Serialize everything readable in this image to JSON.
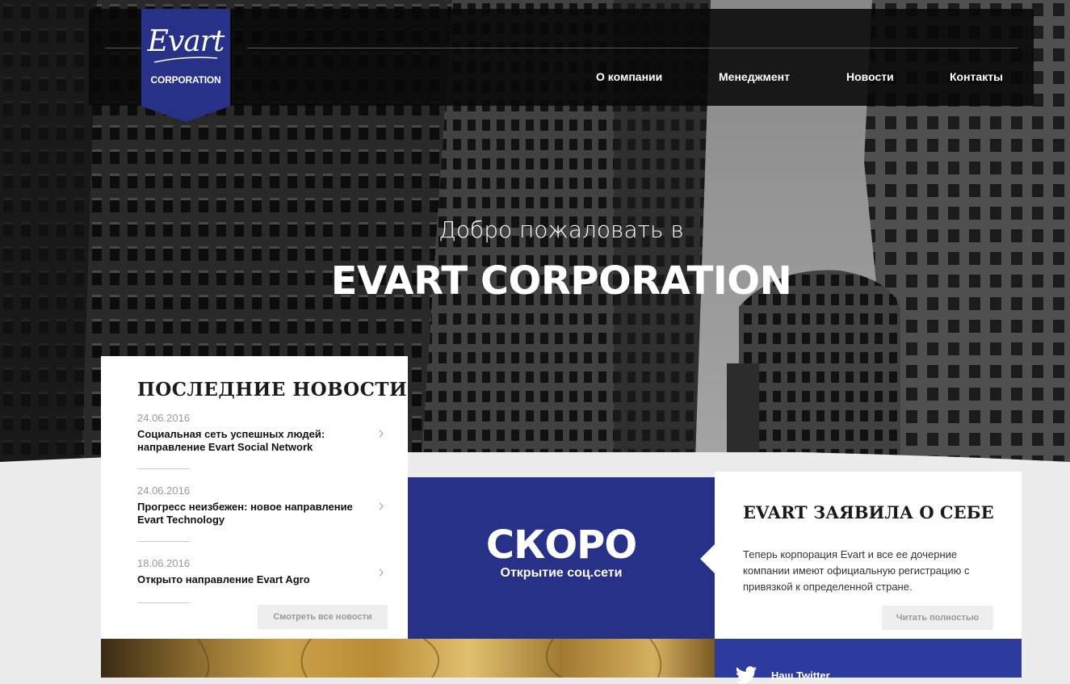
{
  "brand": {
    "logo_script": "Evart",
    "logo_corporation": "CORPORATION",
    "accent": "#273188"
  },
  "nav": {
    "items": [
      {
        "label": "О компании"
      },
      {
        "label": "Менеджмент"
      },
      {
        "label": "Новости"
      },
      {
        "label": "Контакты"
      }
    ]
  },
  "hero": {
    "welcome": "Добро пожаловать в",
    "title": "EVART CORPORATION"
  },
  "news": {
    "heading": "ПОСЛЕДНИЕ НОВОСТИ",
    "items": [
      {
        "date": "24.06.2016",
        "title": "Социальная сеть успешных людей: направление Evart Social Network"
      },
      {
        "date": "24.06.2016",
        "title": "Прогресс неизбежен: новое направление Evart Technology"
      },
      {
        "date": "18.06.2016",
        "title": "Открыто направление Evart Agro"
      }
    ],
    "all_button": "Смотреть все новости"
  },
  "soon": {
    "title": "СКОРО",
    "subtitle": "Открытие соц.сети"
  },
  "statement": {
    "heading": "EVART ЗАЯВИЛА О СЕБЕ",
    "text": "Теперь корпорация Evart и все ее дочерние компании имеют официальную регистрацию с привязкой к определенной стране.",
    "read_button": "Читать полностью"
  },
  "twitter": {
    "label": "Наш Twitter",
    "icon": "twitter-bird-icon"
  }
}
